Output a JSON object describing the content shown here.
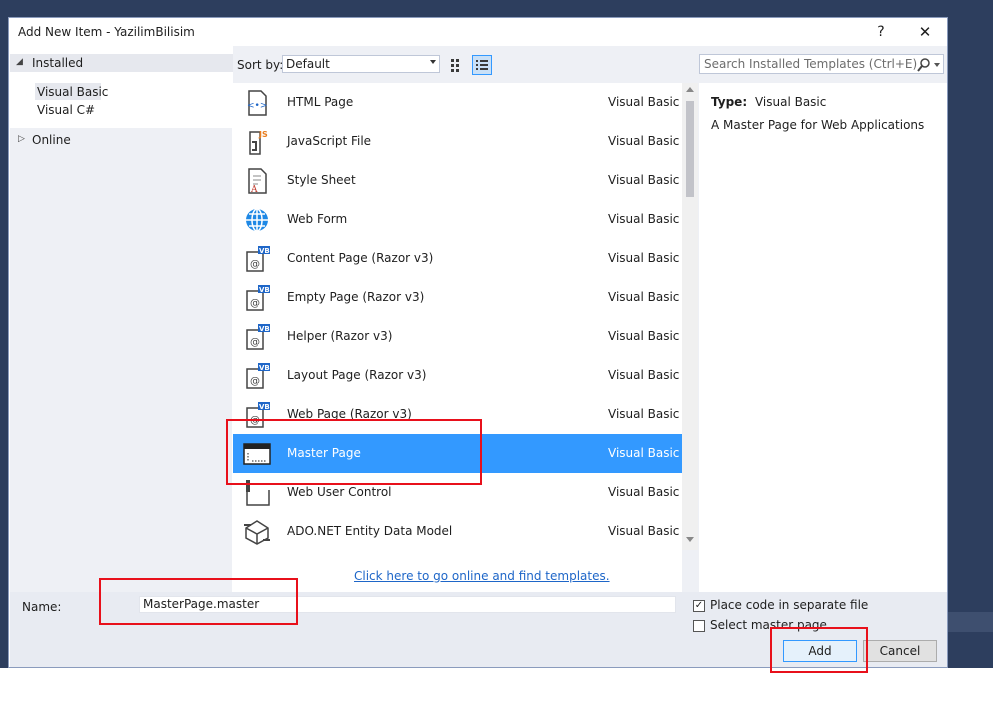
{
  "dialog": {
    "title": "Add New Item - YazilimBilisim",
    "help_label": "?",
    "close_label": "✕"
  },
  "tree": {
    "installed": "Installed",
    "visual_basic": "Visual Basic",
    "visual_csharp": "Visual C#",
    "online": "Online"
  },
  "toolbar": {
    "sort_label": "Sort by:",
    "sort_value": "Default"
  },
  "templates": [
    {
      "name": "HTML Page",
      "lang": "Visual Basic",
      "icon": "html-page-icon"
    },
    {
      "name": "JavaScript File",
      "lang": "Visual Basic",
      "icon": "javascript-file-icon"
    },
    {
      "name": "Style Sheet",
      "lang": "Visual Basic",
      "icon": "style-sheet-icon"
    },
    {
      "name": "Web Form",
      "lang": "Visual Basic",
      "icon": "web-form-globe-icon"
    },
    {
      "name": "Content Page (Razor v3)",
      "lang": "Visual Basic",
      "icon": "razor-vb-icon"
    },
    {
      "name": "Empty Page (Razor v3)",
      "lang": "Visual Basic",
      "icon": "razor-vb-icon"
    },
    {
      "name": "Helper (Razor v3)",
      "lang": "Visual Basic",
      "icon": "razor-vb-icon"
    },
    {
      "name": "Layout Page (Razor v3)",
      "lang": "Visual Basic",
      "icon": "razor-vb-icon"
    },
    {
      "name": "Web Page (Razor v3)",
      "lang": "Visual Basic",
      "icon": "razor-vb-icon"
    },
    {
      "name": "Master Page",
      "lang": "Visual Basic",
      "icon": "master-page-icon",
      "selected": true
    },
    {
      "name": "Web User Control",
      "lang": "Visual Basic",
      "icon": "web-user-control-icon"
    },
    {
      "name": "ADO.NET Entity Data Model",
      "lang": "Visual Basic",
      "icon": "entity-data-model-icon"
    }
  ],
  "online_link": "Click here to go online and find templates.",
  "search": {
    "placeholder": "Search Installed Templates (Ctrl+E)"
  },
  "details": {
    "type_label": "Type:",
    "type_value": "Visual Basic",
    "description": "A Master Page for Web Applications"
  },
  "bottom": {
    "name_label": "Name:",
    "name_value": "MasterPage.master",
    "place_code_label": "Place code in separate file",
    "place_code_checked": true,
    "select_master_label": "Select master page",
    "select_master_checked": false,
    "add_label": "Add",
    "cancel_label": "Cancel"
  },
  "colors": {
    "selection": "#3399ff",
    "highlight": "#e8101b",
    "link": "#1e66c8",
    "backdrop": "#2d3e5e"
  }
}
